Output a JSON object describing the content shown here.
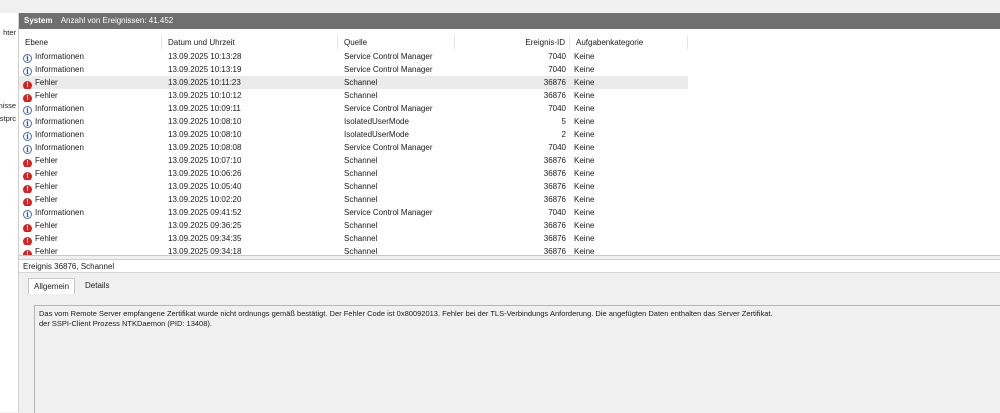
{
  "left_nav_fragments": [
    "hter",
    "nisse",
    "stprc"
  ],
  "header": {
    "log_name": "System",
    "event_count": "Anzahl von Ereignissen: 41.452"
  },
  "columns": [
    "Ebene",
    "Datum und Uhrzeit",
    "Quelle",
    "Ereignis-ID",
    "Aufgabenkategorie"
  ],
  "events": [
    {
      "level": "Informationen",
      "type": "info",
      "datetime": "13.09.2025 10:13:28",
      "source": "Service Control Manager",
      "id": "7040",
      "category": "Keine"
    },
    {
      "level": "Informationen",
      "type": "info",
      "datetime": "13.09.2025 10:13:19",
      "source": "Service Control Manager",
      "id": "7040",
      "category": "Keine"
    },
    {
      "level": "Fehler",
      "type": "err",
      "datetime": "13.09.2025 10:11:23",
      "source": "Schannel",
      "id": "36876",
      "category": "Keine",
      "selected": true
    },
    {
      "level": "Fehler",
      "type": "err",
      "datetime": "13.09.2025 10:10:12",
      "source": "Schannel",
      "id": "36876",
      "category": "Keine"
    },
    {
      "level": "Informationen",
      "type": "info",
      "datetime": "13.09.2025 10:09:11",
      "source": "Service Control Manager",
      "id": "7040",
      "category": "Keine"
    },
    {
      "level": "Informationen",
      "type": "info",
      "datetime": "13.09.2025 10:08:10",
      "source": "IsolatedUserMode",
      "id": "5",
      "category": "Keine"
    },
    {
      "level": "Informationen",
      "type": "info",
      "datetime": "13.09.2025 10:08:10",
      "source": "IsolatedUserMode",
      "id": "2",
      "category": "Keine"
    },
    {
      "level": "Informationen",
      "type": "info",
      "datetime": "13.09.2025 10:08:08",
      "source": "Service Control Manager",
      "id": "7040",
      "category": "Keine"
    },
    {
      "level": "Fehler",
      "type": "err",
      "datetime": "13.09.2025 10:07:10",
      "source": "Schannel",
      "id": "36876",
      "category": "Keine"
    },
    {
      "level": "Fehler",
      "type": "err",
      "datetime": "13.09.2025 10:06:26",
      "source": "Schannel",
      "id": "36876",
      "category": "Keine"
    },
    {
      "level": "Fehler",
      "type": "err",
      "datetime": "13.09.2025 10:05:40",
      "source": "Schannel",
      "id": "36876",
      "category": "Keine"
    },
    {
      "level": "Fehler",
      "type": "err",
      "datetime": "13.09.2025 10:02:20",
      "source": "Schannel",
      "id": "36876",
      "category": "Keine"
    },
    {
      "level": "Informationen",
      "type": "info",
      "datetime": "13.09.2025 09:41:52",
      "source": "Service Control Manager",
      "id": "7040",
      "category": "Keine"
    },
    {
      "level": "Fehler",
      "type": "err",
      "datetime": "13.09.2025 09:36:25",
      "source": "Schannel",
      "id": "36876",
      "category": "Keine"
    },
    {
      "level": "Fehler",
      "type": "err",
      "datetime": "13.09.2025 09:34:35",
      "source": "Schannel",
      "id": "36876",
      "category": "Keine"
    },
    {
      "level": "Fehler",
      "type": "err",
      "datetime": "13.09.2025 09:34:18",
      "source": "Schannel",
      "id": "36876",
      "category": "Keine"
    }
  ],
  "icons": {
    "info": "information-icon",
    "err": "error-icon",
    "info_glyph": "i",
    "err_glyph": "!"
  },
  "detail": {
    "title": "Ereignis 36876, Schannel",
    "tabs": [
      "Allgemein",
      "Details"
    ],
    "active_tab": "Allgemein",
    "message_lines": [
      "Das vom Remote Server empfangene Zertifikat wurde nicht ordnungs gemäß bestätigt. Der Fehler Code ist 0x80092013. Fehler bei der TLS-Verbindungs Anforderung. Die angefügten Daten enthalten das Server Zertifikat.",
      "der SSPI-Client Prozess NTKDaemon (PID: 13408)."
    ]
  },
  "colors": {
    "header_bg": "#6f6f6f",
    "selected_row": "#ebebeb",
    "error_red": "#d22424",
    "info_blue": "#4a6fb0"
  }
}
